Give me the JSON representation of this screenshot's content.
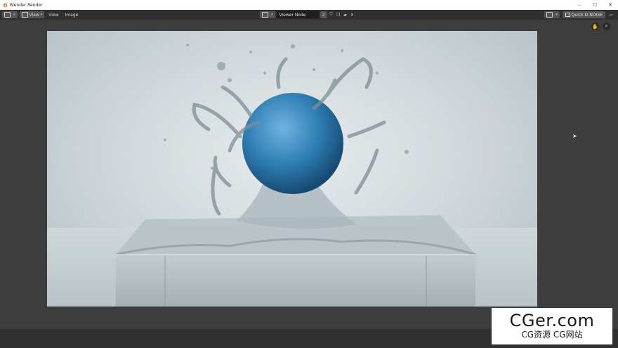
{
  "window": {
    "title": "Blender Render",
    "controls": {
      "minimize": "–",
      "maximize": "☐",
      "close": "✕"
    }
  },
  "header": {
    "menus": [
      "View",
      "View",
      "Image"
    ],
    "viewer": {
      "name": "Viewer Node",
      "slot": "2"
    },
    "denoise_label": "Quick D-NOISE"
  },
  "nav": {
    "pan_icon": "hand-icon",
    "zoom_icon": "magnifier-icon"
  },
  "watermark": {
    "main": "CGer.com",
    "sub": "CG资源 CG网站"
  },
  "colors": {
    "background": "#3d3d3d",
    "header": "#303030",
    "sphere": "#2f7fb5",
    "water": "#c8d3d8"
  }
}
